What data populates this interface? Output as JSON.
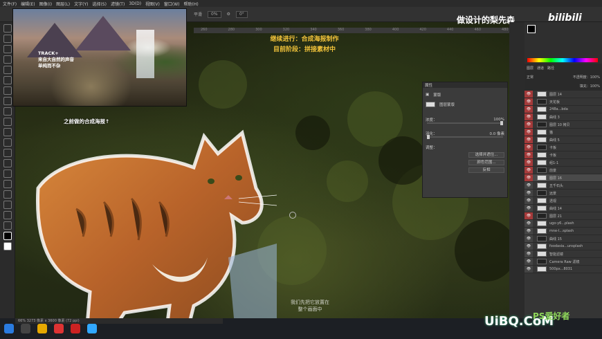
{
  "menubar": {
    "items": [
      "文件(F)",
      "编辑(E)",
      "图像(I)",
      "图层(L)",
      "文字(Y)",
      "选择(S)",
      "滤镜(T)",
      "3D(D)",
      "视图(V)",
      "窗口(W)",
      "帮助(H)"
    ]
  },
  "options": {
    "flow_label": "平滑",
    "flow_value": "0%",
    "angle_value": "0°"
  },
  "reference": {
    "line1": "TRACK+",
    "line2": "来自大自然的声音",
    "line3": "单纯而不杂"
  },
  "caption": {
    "line1": "继续进行：合成海报制作",
    "line2": "目前阶段：拼接素材中"
  },
  "brand": {
    "text": "做设计的梨先森",
    "bili": "bilibili"
  },
  "prev_caption": "之前做的合成海报↑",
  "subtitle": {
    "line1": "我们先把它放置在",
    "line2": "整个画面中"
  },
  "properties": {
    "title": "属性",
    "section": "蒙版",
    "mask_label": "图层蒙版",
    "density_label": "浓度：",
    "density_value": "100%",
    "feather_label": "羽化：",
    "feather_value": "0.0 像素",
    "adjust_label": "调整：",
    "btn_select": "选择并遮住...",
    "btn_color": "颜色范围...",
    "btn_invert": "反相"
  },
  "layers": {
    "tabs": [
      "图层",
      "通道",
      "路径"
    ],
    "blend": "正常",
    "opacity": "不透明度：100%",
    "fill": "填充：100%",
    "rows": [
      {
        "name": "图层 14",
        "red": true
      },
      {
        "name": "天花板",
        "red": true
      },
      {
        "name": "248a...bda",
        "red": true
      },
      {
        "name": "曲线 3",
        "red": true
      },
      {
        "name": "图层 10 拷贝",
        "red": true
      },
      {
        "name": "猫",
        "red": true
      },
      {
        "name": "曲线 5",
        "red": true
      },
      {
        "name": "卡板",
        "red": true
      },
      {
        "name": "卡板",
        "red": true
      },
      {
        "name": "组1-1",
        "red": true
      },
      {
        "name": "前景",
        "red": true
      },
      {
        "name": "图层 16",
        "red": true,
        "sel": true
      },
      {
        "name": "五千石头",
        "red": false
      },
      {
        "name": "远景",
        "red": false
      },
      {
        "name": "透视",
        "red": false
      },
      {
        "name": "曲线 14",
        "red": false
      },
      {
        "name": "图层 21",
        "red": true
      },
      {
        "name": "ugo-y6...plash",
        "red": false
      },
      {
        "name": "mne-l...splash",
        "red": false
      },
      {
        "name": "曲线 15",
        "red": false
      },
      {
        "name": "foodasia...unsplash",
        "red": false
      },
      {
        "name": "智能滤镜",
        "red": false
      },
      {
        "name": "Camera Raw 滤镜",
        "red": false
      },
      {
        "name": "500px...8031",
        "red": false
      }
    ]
  },
  "status": {
    "zoom": "66%",
    "doc": "3273 像素 x 3600 像素 (72 ppi)"
  },
  "watermark": {
    "text": "UiBQ.CoM",
    "ps": "PS爱好者"
  }
}
